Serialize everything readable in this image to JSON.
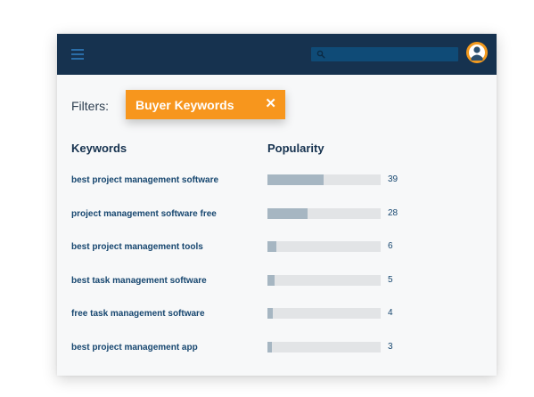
{
  "filters": {
    "label": "Filters:",
    "chip_label": "Buyer Keywords",
    "chip_close": "✕"
  },
  "table": {
    "headers": {
      "keywords": "Keywords",
      "popularity": "Popularity"
    },
    "max_popularity": 79,
    "rows": [
      {
        "keyword": "best project management software",
        "popularity": 39
      },
      {
        "keyword": "project management software free",
        "popularity": 28
      },
      {
        "keyword": "best project management tools",
        "popularity": 6
      },
      {
        "keyword": "best task management software",
        "popularity": 5
      },
      {
        "keyword": "free task management software",
        "popularity": 4
      },
      {
        "keyword": "best project management app",
        "popularity": 3
      }
    ]
  },
  "icons": {
    "menu": "hamburger-menu-icon",
    "search": "search-icon",
    "avatar": "user-avatar-icon",
    "close": "close-icon"
  },
  "colors": {
    "topbar": "#16324f",
    "search_box": "#0f4b77",
    "accent": "#f7961d",
    "bar_fill": "#a6b6c2",
    "bar_track": "#e2e4e6",
    "text_dark": "#16324f"
  }
}
